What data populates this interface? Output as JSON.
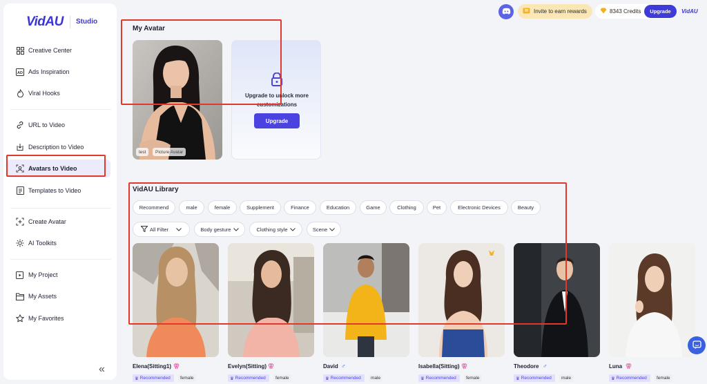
{
  "sidebar": {
    "logo": "VidAU",
    "studio": "Studio",
    "items": [
      {
        "label": "Creative Center",
        "icon": "grid-icon"
      },
      {
        "label": "Ads Inspiration",
        "icon": "ad-icon"
      },
      {
        "label": "Viral Hooks",
        "icon": "flame-icon"
      },
      {
        "label": "URL to Video",
        "icon": "link-icon"
      },
      {
        "label": "Description to Video",
        "icon": "import-icon"
      },
      {
        "label": "Avatars to Video",
        "icon": "avatar-scan-icon"
      },
      {
        "label": "Templates to Video",
        "icon": "template-icon"
      },
      {
        "label": "Create Avatar",
        "icon": "add-square-icon"
      },
      {
        "label": "AI Toolkits",
        "icon": "sparkle-icon"
      },
      {
        "label": "My Project",
        "icon": "folder-video-icon"
      },
      {
        "label": "My Assets",
        "icon": "folder-icon"
      },
      {
        "label": "My Favorites",
        "icon": "star-icon"
      }
    ],
    "collapse": "«"
  },
  "topbar": {
    "invite": "Invite to earn rewards",
    "credits": "8343 Credits",
    "upgrade": "Upgrade",
    "mini_logo": "VidAU"
  },
  "my_avatar": {
    "title": "My Avatar",
    "tags": [
      "test",
      "Picture Avatar"
    ],
    "upgrade_text": "Upgrade to unlock more customizations",
    "upgrade_button": "Upgrade"
  },
  "library": {
    "title": "VidAU Library",
    "chips": [
      "Recommend",
      "male",
      "female",
      "Supplement",
      "Finance",
      "Education",
      "Game",
      "Clothing",
      "Pet",
      "Electronic Devices",
      "Beauty"
    ],
    "filters": [
      "All Filter",
      "Body gesture",
      "Clothing style",
      "Scene"
    ],
    "avatars": [
      {
        "name": "Elena(Sitting1)",
        "gender": "female",
        "badge": "Recommended"
      },
      {
        "name": "Evelyn(Sitting)",
        "gender": "female",
        "badge": "Recommended"
      },
      {
        "name": "David",
        "gender": "male",
        "badge": "Recommended"
      },
      {
        "name": "Isabella(Sitting)",
        "gender": "female",
        "badge": "Recommended"
      },
      {
        "name": "Theodore",
        "gender": "male",
        "badge": "Recommended"
      },
      {
        "name": "Luna",
        "gender": "female",
        "badge": "Recommended"
      }
    ]
  },
  "colors": {
    "accent": "#3f3bd8",
    "highlight_box": "#e0392b",
    "female_symbol": "#e0489a",
    "male_symbol": "#3a6fe0"
  }
}
